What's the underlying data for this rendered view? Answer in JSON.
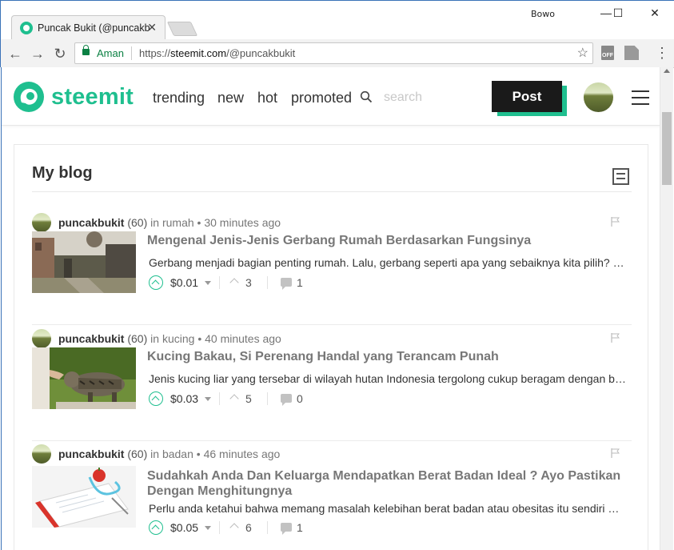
{
  "browser": {
    "tab_title": "Puncak Bukit (@puncakbukit)",
    "profile": "Bowo",
    "secure_label": "Aman",
    "url_scheme": "https://",
    "url_host": "steemit.com",
    "url_path": "/@puncakbukit"
  },
  "header": {
    "logo_text": "steemit",
    "nav": [
      "trending",
      "new",
      "hot",
      "promoted"
    ],
    "search_placeholder": "search",
    "post_label": "Post"
  },
  "blog": {
    "title": "My blog",
    "posts": [
      {
        "author": "puncakbukit",
        "reputation": "(60)",
        "in_word": "in",
        "category": "rumah",
        "time": "30 minutes ago",
        "title": "Mengenal Jenis-Jenis Gerbang Rumah Berdasarkan Fungsinya",
        "excerpt": "Gerbang menjadi bagian penting rumah. Lalu, gerbang seperti apa yang sebaiknya kita pilih? Berikut ulasannya",
        "payout": "$0.01",
        "votes": "3",
        "comments": "1"
      },
      {
        "author": "puncakbukit",
        "reputation": "(60)",
        "in_word": "in",
        "category": "kucing",
        "time": "40 minutes ago",
        "title": "Kucing Bakau, Si Perenang Handal yang Terancam Punah",
        "excerpt": "Jenis kucing liar yang tersebar di wilayah hutan Indonesia tergolong cukup beragam dengan berbagai keunikan",
        "payout": "$0.03",
        "votes": "5",
        "comments": "0"
      },
      {
        "author": "puncakbukit",
        "reputation": "(60)",
        "in_word": "in",
        "category": "badan",
        "time": "46 minutes ago",
        "title": "Sudahkah Anda Dan Keluarga Mendapatkan Berat Badan Ideal ? Ayo Pastikan Dengan Menghitungnya",
        "excerpt": "Perlu anda ketahui bahwa memang masalah kelebihan berat badan atau obesitas itu sendiri merupakan masalah",
        "payout": "$0.05",
        "votes": "6",
        "comments": "1"
      }
    ]
  },
  "colors": {
    "brand": "#1fbf8f",
    "post_button": "#1a1a1a",
    "secure": "#0b8043"
  }
}
